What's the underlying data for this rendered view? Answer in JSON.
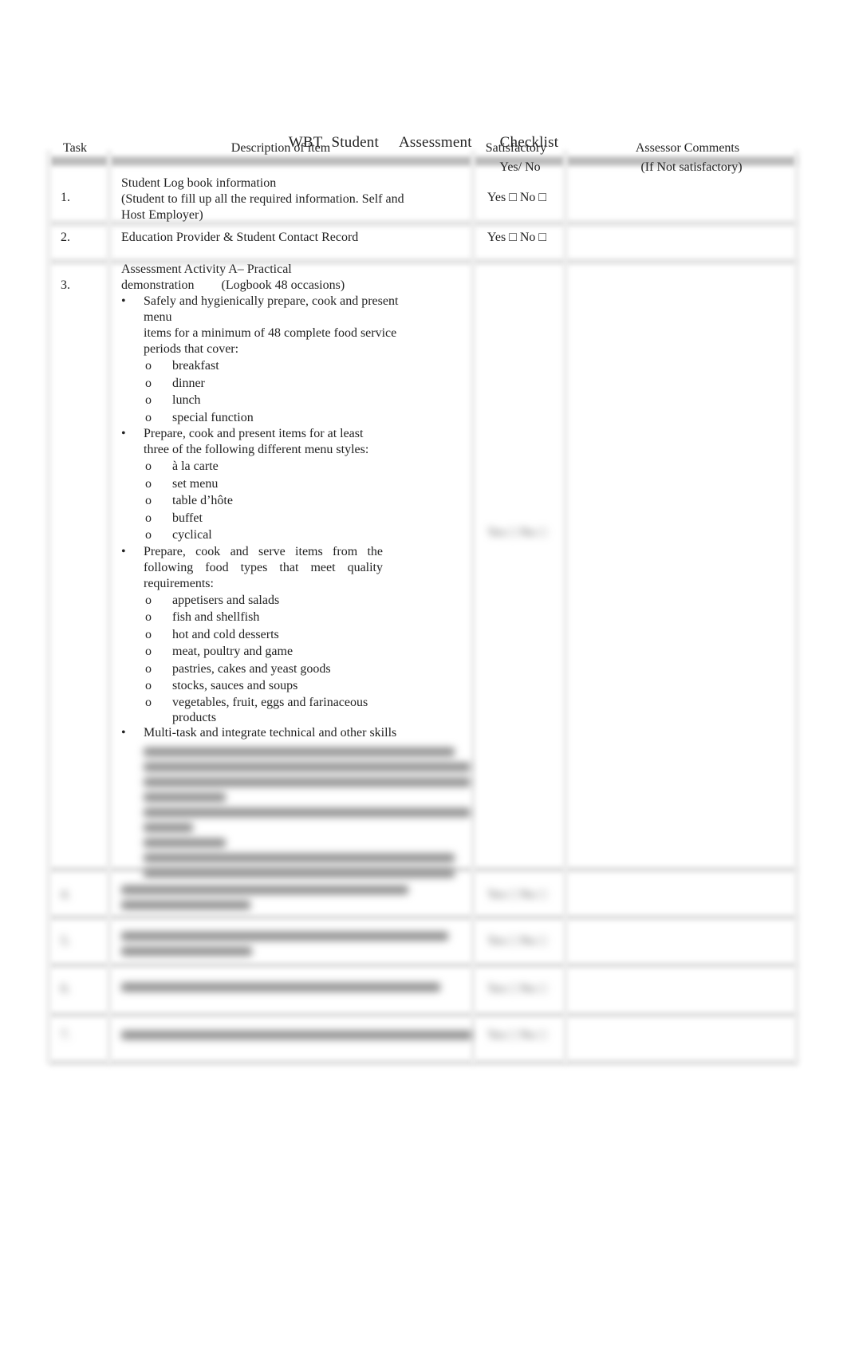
{
  "document": {
    "title_words": [
      "WBT",
      "Student",
      "Assessment",
      "Checklist"
    ]
  },
  "table": {
    "headers": {
      "task": "Task",
      "description": "Description of item",
      "satisfactory_line1": "Satisfactory",
      "satisfactory_line2": "Yes/ No",
      "comments_line1": "Assessor Comments",
      "comments_line2": "(If Not satisfactory)"
    },
    "checkbox_label": "Yes □ No □",
    "rows": [
      {
        "task": "1.",
        "title": "Student Log book information",
        "detail": "(Student to fill up all the required information. Self and Host Employer)",
        "satisfactory": "Yes □ No □"
      },
      {
        "task": "2.",
        "title": "Education Provider & Student Contact Record",
        "satisfactory": "Yes □ No □"
      },
      {
        "task": "3.",
        "title_line1": "Assessment Activity A– Practical",
        "title_line2": "demonstration",
        "title_note": "(Logbook 48 occasions)",
        "bullets": [
          {
            "text_line1": "Safely and hygienically prepare, cook and present menu",
            "text_line2": "items for a minimum of 48 complete food service periods that cover:",
            "subitems": [
              "breakfast",
              "dinner",
              "lunch",
              "special function"
            ]
          },
          {
            "text": "Prepare, cook and present items for at least three of the following different menu styles:",
            "subitems": [
              "à la carte",
              "set menu",
              "table d’hôte",
              "buffet",
              "cyclical"
            ]
          },
          {
            "text": "Prepare, cook and serve items from the following food types that meet quality requirements:",
            "subitems": [
              "appetisers and salads",
              "fish and shellfish",
              "hot and cold desserts",
              "meat, poultry and game",
              "pastries, cakes and yeast goods",
              "stocks, sauces and soups",
              "vegetables, fruit, eggs and farinaceous products"
            ]
          },
          {
            "text": "Multi-task and integrate technical and other skills"
          }
        ],
        "sub_bullet_marker": "o",
        "bullet_marker": "•",
        "satisfactory": "Yes □ No □",
        "remaining_content_blurred": true
      },
      {
        "task": "4.",
        "content_blurred": true,
        "satisfactory": "Yes □ No □"
      },
      {
        "task": "5.",
        "content_blurred": true,
        "satisfactory": "Yes □ No □"
      },
      {
        "task": "6.",
        "content_blurred": true,
        "satisfactory": "Yes □ No □"
      },
      {
        "task": "7.",
        "content_blurred": true,
        "satisfactory": "Yes □ No □"
      }
    ]
  }
}
